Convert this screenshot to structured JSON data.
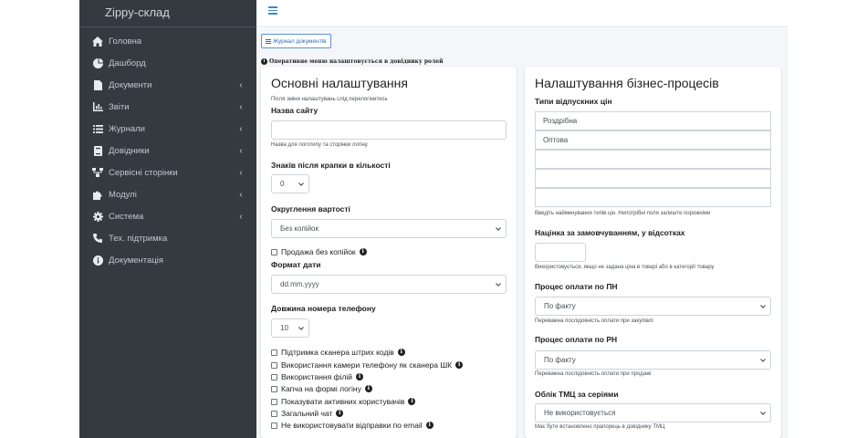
{
  "sidebar": {
    "brand": "Zippy-склад",
    "items": [
      {
        "label": "Головна",
        "icon": "home-icon",
        "chevron": ""
      },
      {
        "label": "Дашборд",
        "icon": "dashboard-icon",
        "chevron": ""
      },
      {
        "label": "Документи",
        "icon": "file-icon",
        "chevron": "‹"
      },
      {
        "label": "Звіти",
        "icon": "chart-icon",
        "chevron": "‹"
      },
      {
        "label": "Журнали",
        "icon": "list-icon",
        "chevron": "‹"
      },
      {
        "label": "Довідники",
        "icon": "book-icon",
        "chevron": "‹"
      },
      {
        "label": "Сервісні сторінки",
        "icon": "sitemap-icon",
        "chevron": "‹"
      },
      {
        "label": "Модулі",
        "icon": "puzzle-icon",
        "chevron": "‹"
      },
      {
        "label": "Система",
        "icon": "gear-icon",
        "chevron": "‹"
      },
      {
        "label": "Тех. підтримка",
        "icon": "phone-icon",
        "chevron": ""
      },
      {
        "label": "Документація",
        "icon": "info-circle-icon",
        "chevron": ""
      }
    ]
  },
  "toolbar": {
    "journal_button": "Журнал документів",
    "notice": "Оперативне меню налаштовується в довіднику ролей"
  },
  "main_settings": {
    "title": "Основні налаштування",
    "relogin_hint": "Після зміни налаштувань слід перелогінитись",
    "site_name_label": "Назва сайту",
    "site_name_value": "",
    "site_name_hint": "Назва для логотипу та сторінки логіну.",
    "decimals_label": "Знаків після крапки в кількості",
    "decimals_value": "0",
    "rounding_label": "Округлення вартості",
    "rounding_value": "Без копійок",
    "sale_no_kopecks": "Продажа без копійок",
    "date_format_label": "Формат дати",
    "date_format_value": "dd.mm.yyyy",
    "phone_length_label": "Довжина номера телефону",
    "phone_length_value": "10",
    "checkboxes": [
      "Підтримка сканера штрих кодів",
      "Використання камери телефону як сканера ШК",
      "Використання філій",
      "Капча на формі логіну",
      "Показувати активних користувачів",
      "Загальний чат",
      "Не використовувати відправки по email"
    ]
  },
  "business_settings": {
    "title": "Налаштування бізнес-процесів",
    "price_types_label": "Типи відпускних цін",
    "price_types": [
      "Роздрібна",
      "Оптова",
      "",
      "",
      ""
    ],
    "price_types_hint": "Введіть найменування типів цін. Непотрібні поля залиште порожніми",
    "markup_label": "Націнка за замовчуванням, у відсотках",
    "markup_value": "",
    "markup_hint": "Використовується, якщо не задана ціна в товарі або в категорії товару",
    "pn_label": "Процес оплати по ПН",
    "pn_value": "По факту",
    "pn_hint": "Переважна послідовність оплати при закупівлі",
    "rn_label": "Процес оплати по РН",
    "rn_value": "По факту",
    "rn_hint": "Переважна послідовність оплати при продажі",
    "series_label": "Облік ТМЦ за серіями",
    "series_value": "Не використовується",
    "series_hint": "Має бути встановлено прапорець в довіднику ТМЦ"
  },
  "colors": {
    "sidebar_bg": "#343a40",
    "accent": "#3c8dbc",
    "content_bg": "#f4f6f9"
  }
}
